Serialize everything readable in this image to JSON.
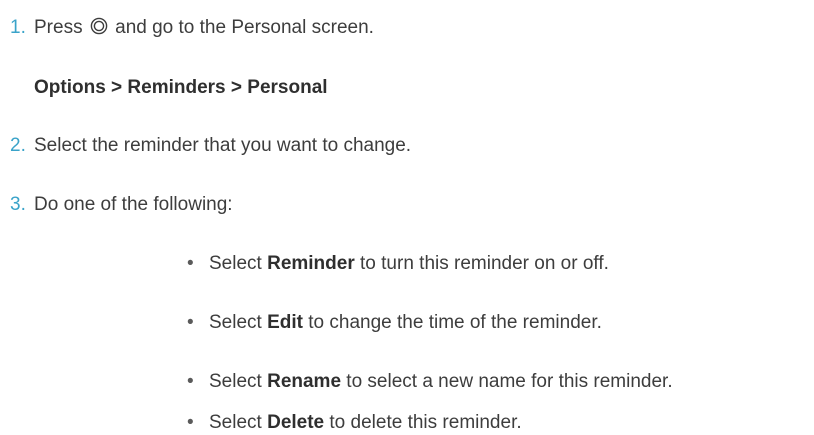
{
  "steps": [
    {
      "number": "1.",
      "before": "Press",
      "icon": "home-button-icon",
      "after": "and go to the Personal screen."
    },
    {
      "number": "2.",
      "text": "Select the reminder that you want to change."
    },
    {
      "number": "3.",
      "text": "Do one of the following:"
    }
  ],
  "nav_path": "Options > Reminders > Personal",
  "options": [
    {
      "prefix": "Select",
      "bold": "Reminder",
      "suffix": "to turn this reminder on or off."
    },
    {
      "prefix": "Select",
      "bold": "Edit",
      "suffix": "to change the time of the reminder."
    },
    {
      "prefix": "Select",
      "bold": "Rename",
      "suffix": "to select a new name for this reminder."
    },
    {
      "prefix": "Select",
      "bold": "Delete",
      "suffix": "to delete this reminder."
    }
  ],
  "bullet_char": "•",
  "colors": {
    "step_number": "#3aa3c9",
    "text": "#3d3d3d"
  }
}
